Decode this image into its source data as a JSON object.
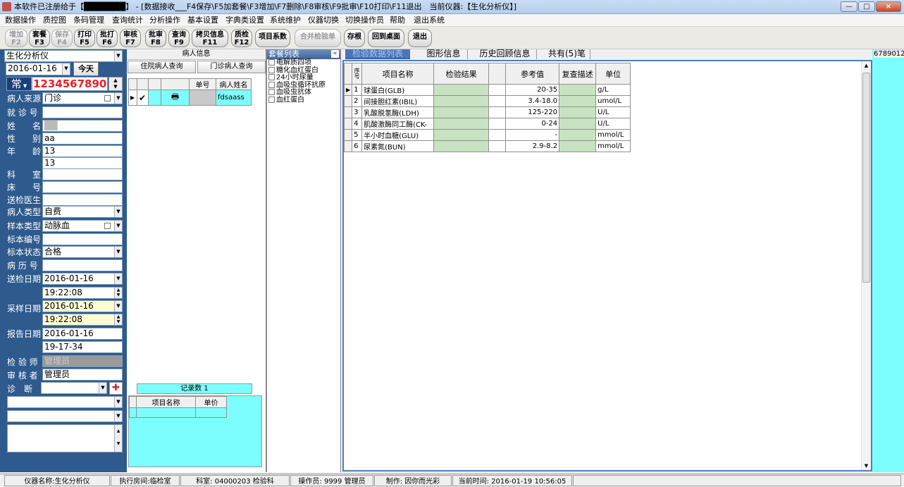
{
  "title": "本软件已注册给于【███████】 - [数据接收___F4保存\\F5加套餐\\F3增加\\F7删除\\F8审核\\F9批审\\F10打印\\F11退出　当前仪器:【生化分析仪】]",
  "window_controls": {
    "minimize": "—",
    "maximize": "□",
    "close": "×"
  },
  "menu": [
    "数据操作",
    "质控图",
    "条码管理",
    "查询统计",
    "分析操作",
    "基本设置",
    "字典类设置",
    "系统维护",
    "仪器切换",
    "切换操作员",
    "帮助",
    "退出系统"
  ],
  "toolbar": [
    {
      "label": "增加",
      "key": "F2",
      "disabled": true
    },
    {
      "label": "套餐",
      "key": "F3",
      "disabled": false
    },
    {
      "label": "保存",
      "key": "F4",
      "disabled": true
    },
    {
      "label": "打印",
      "key": "F5",
      "disabled": false
    },
    {
      "label": "批打",
      "key": "F6",
      "disabled": false
    },
    {
      "label": "审核",
      "key": "F7",
      "disabled": false
    },
    {
      "label": "批审",
      "key": "F8",
      "disabled": false
    },
    {
      "label": "查询",
      "key": "F9",
      "disabled": false
    },
    {
      "label": "拷贝信息",
      "key": "F11",
      "disabled": false
    },
    {
      "label": "质检",
      "key": "F12",
      "disabled": false
    },
    {
      "label": "项目系数",
      "key": "",
      "disabled": false
    },
    {
      "label": "合并检验单",
      "key": "",
      "disabled": true
    },
    {
      "label": "存根",
      "key": "",
      "disabled": false
    },
    {
      "label": "回到桌面",
      "key": "",
      "disabled": false
    },
    {
      "label": "退出",
      "key": "",
      "disabled": false
    }
  ],
  "left": {
    "instrument": "生化分析仪",
    "date": "2016-01-16",
    "today_button": "今天",
    "sample_type_badge": "常",
    "sample_number": "123456789012",
    "fields": [
      {
        "label": "病人来源",
        "value": "门诊"
      },
      {
        "label": "就 诊 号",
        "value": ""
      },
      {
        "label": "姓　　名",
        "value": "██"
      },
      {
        "label": "性　　别",
        "value": "aa"
      },
      {
        "label": "年　　龄",
        "value": "13"
      },
      {
        "label": "",
        "value": "13"
      },
      {
        "label": "科　　室",
        "value": ""
      },
      {
        "label": "床　　号",
        "value": ""
      },
      {
        "label": "送检医生",
        "value": ""
      },
      {
        "label": "病人类型",
        "value": "自费"
      },
      {
        "label": "样本类型",
        "value": "动脉血"
      },
      {
        "label": "标本编号",
        "value": ""
      },
      {
        "label": "标本状态",
        "value": "合格"
      },
      {
        "label": "病 历 号",
        "value": ""
      }
    ],
    "send_date_label": "送检日期",
    "send_date": "2016-01-16",
    "send_time": "19:22:08",
    "collect_date_label": "采样日期",
    "collect_date": "2016-01-16",
    "collect_time": "19:22:08",
    "report_date_label": "报告日期",
    "report_date": "2016-01-16",
    "report_time": "19-17-34",
    "tester_label": "检 验 师",
    "tester": "管理员",
    "reviewer_label": "审 核 者",
    "reviewer": "管理员",
    "diagnosis_label": "诊　断"
  },
  "patient": {
    "header": "病人信息",
    "inpatient_btn": "住院病人查询",
    "outpatient_btn": "门诊病人查询",
    "col_no": "单号",
    "col_name": "病人姓名",
    "row_no": "",
    "row_name": "fdsaass",
    "record_count": "记录数 1",
    "fee_col_item": "项目名称",
    "fee_col_price": "单价"
  },
  "sets": {
    "header": "套餐列表",
    "collapse": "«",
    "items": [
      "电解质四项",
      "糖化血红蛋白",
      "24小时尿量",
      "血吸虫循环抗原",
      "血吸虫抗体",
      "血红蛋白"
    ]
  },
  "tabs": [
    "检验数据列表",
    "图形信息",
    "历史回顾信息",
    "共有(5)笔"
  ],
  "results": {
    "columns": [
      "序号",
      "项目名称",
      "检验结果",
      "",
      "参考值",
      "复查描述",
      "单位"
    ],
    "rows": [
      {
        "no": "1",
        "name": "球蛋白(GLB)",
        "result": "",
        "ref": "20-35",
        "recheck": "",
        "unit": "g/L"
      },
      {
        "no": "2",
        "name": "间接胆红素(IBIL)",
        "result": "",
        "ref": "3.4-18.0",
        "recheck": "",
        "unit": "umol/L"
      },
      {
        "no": "3",
        "name": "乳酸脱氢酶(LDH)",
        "result": "",
        "ref": "125-220",
        "recheck": "",
        "unit": "U/L"
      },
      {
        "no": "4",
        "name": "肌酸激酶同工酶(CK-",
        "result": "",
        "ref": "0-24",
        "recheck": "",
        "unit": "U/L"
      },
      {
        "no": "5",
        "name": "半小时血糖(GLU)",
        "result": "",
        "ref": "-",
        "recheck": "",
        "unit": "mmol/L"
      },
      {
        "no": "6",
        "name": "尿素氮(BUN)",
        "result": "",
        "ref": "2.9-8.2",
        "recheck": "",
        "unit": "mmol/L"
      }
    ]
  },
  "far_right_text": "6789012",
  "status": {
    "instrument": "仪器名称:生化分析仪",
    "room": "执行房间:临检室",
    "dept": "科室: 04000203 检验科",
    "operator": "操作员: 9999 管理员",
    "maker": "制作: 因你而光彩",
    "time": "当前时间: 2016-01-19 10:56:05"
  },
  "colors": {
    "panel_blue": "#2e5a8d",
    "cyan": "#7dfefe",
    "result_green": "#c7e3c1",
    "sample_red": "#e8202a"
  }
}
